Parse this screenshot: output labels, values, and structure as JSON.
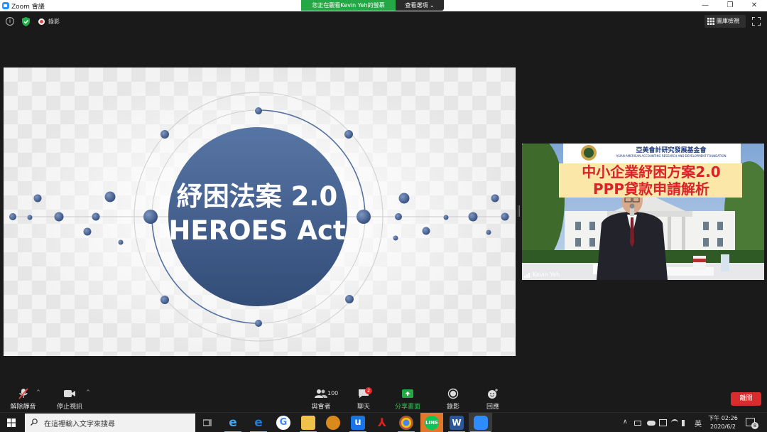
{
  "window": {
    "title": "Zoom 會議",
    "min": "—",
    "max": "❐",
    "close": "✕"
  },
  "share_banner": {
    "text": "您正在觀看Kevin Yeh的螢幕",
    "options_label": "查看選項 ⌄"
  },
  "top_bar": {
    "info": "i",
    "recording_label": "錄影",
    "gallery_view_label": "圖庫檢視"
  },
  "slide": {
    "title_line1": "紓困法案 2.0",
    "title_line2": "HEROES Act"
  },
  "speaker": {
    "name": "Kevin Yeh",
    "banner_org_zh": "亞美會計研究發展基金會",
    "banner_org_en": "ASIAN-AMERICAN ACCOUNTING RESEARCH AND DEVELOPMENT FOUNDATION",
    "banner_line1": "中小企業紓困方案2.0",
    "banner_line2": "PPP貸款申請解析"
  },
  "toolbar": {
    "unmute_label": "解除靜音",
    "stop_video_label": "停止視訊",
    "participants_label": "與會者",
    "participants_count": "100",
    "chat_label": "聊天",
    "chat_badge": "2",
    "share_label": "分享畫面",
    "record_label": "錄影",
    "reactions_label": "回應",
    "leave_label": "離開",
    "caret": "^"
  },
  "taskbar": {
    "search_placeholder": "在這裡輸入文字來搜尋",
    "ime": "英",
    "time": "下午 02:26",
    "date": "2020/6/2",
    "notification_count": "8",
    "tray_up": "∧"
  },
  "colors": {
    "share_green": "#23a845",
    "leave_red": "#d92c2c",
    "slide_navy": "#3f5a8a"
  }
}
